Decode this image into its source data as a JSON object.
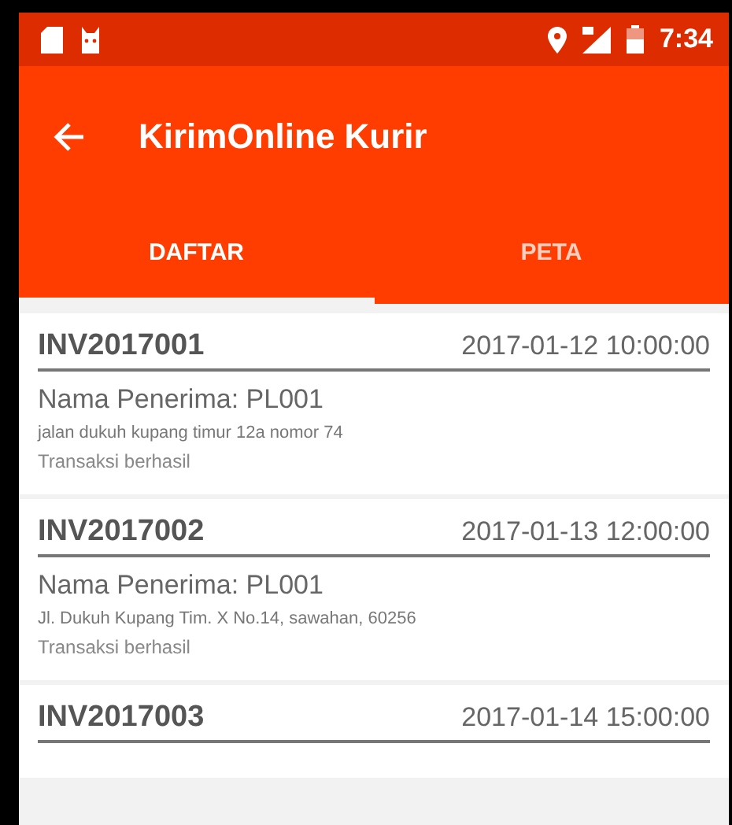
{
  "status_bar": {
    "time": "7:34"
  },
  "toolbar": {
    "title": "KirimOnline Kurir"
  },
  "tabs": [
    {
      "label": "DAFTAR",
      "selected": true
    },
    {
      "label": "PETA",
      "selected": false
    }
  ],
  "orders": [
    {
      "invoice": "INV2017001",
      "datetime": "2017-01-12 10:00:00",
      "recipient": "Nama Penerima: PL001",
      "address": "jalan dukuh kupang timur 12a nomor 74",
      "status": "Transaksi berhasil"
    },
    {
      "invoice": "INV2017002",
      "datetime": "2017-01-13 12:00:00",
      "recipient": "Nama Penerima: PL001",
      "address": "Jl. Dukuh Kupang Tim. X No.14, sawahan, 60256",
      "status": "Transaksi berhasil"
    },
    {
      "invoice": "INV2017003",
      "datetime": "2017-01-14 15:00:00"
    }
  ]
}
